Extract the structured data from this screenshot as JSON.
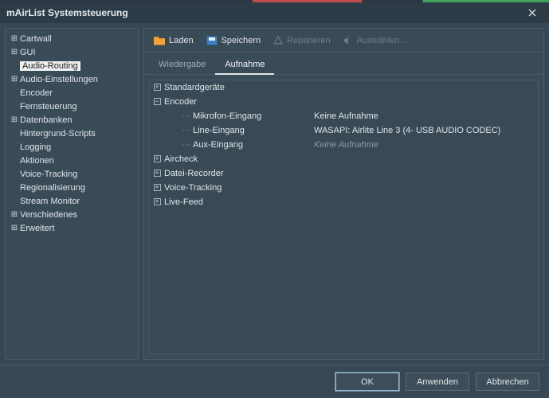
{
  "window": {
    "title": "mAirList Systemsteuerung"
  },
  "sidebar": {
    "items": [
      {
        "label": "Cartwall",
        "expander": "+"
      },
      {
        "label": "GUI",
        "expander": "+"
      },
      {
        "label": "Audio-Routing",
        "expander": "",
        "selected": true
      },
      {
        "label": "Audio-Einstellungen",
        "expander": "+"
      },
      {
        "label": "Encoder",
        "expander": "",
        "indent": 1
      },
      {
        "label": "Fernsteuerung",
        "expander": "",
        "indent": 1
      },
      {
        "label": "Datenbanken",
        "expander": "+"
      },
      {
        "label": "Hintergrund-Scripts",
        "expander": "",
        "indent": 1
      },
      {
        "label": "Logging",
        "expander": "",
        "indent": 1
      },
      {
        "label": "Aktionen",
        "expander": "",
        "indent": 1
      },
      {
        "label": "Voice-Tracking",
        "expander": "",
        "indent": 1
      },
      {
        "label": "Regionalisierung",
        "expander": "",
        "indent": 1
      },
      {
        "label": "Stream Monitor",
        "expander": "",
        "indent": 1
      },
      {
        "label": "Verschiedenes",
        "expander": "+"
      },
      {
        "label": "Erweitert",
        "expander": "+"
      }
    ]
  },
  "toolbar": {
    "load": "Laden",
    "save": "Speichern",
    "repair": "Reparieren",
    "select": "Auswählen…"
  },
  "tabs": {
    "playback": "Wiedergabe",
    "record": "Aufnahme"
  },
  "grid": {
    "rows": [
      {
        "label": "Standardgeräte",
        "exp": "+",
        "lvl": 0
      },
      {
        "label": "Encoder",
        "exp": "−",
        "lvl": 0
      },
      {
        "label": "Mikrofon-Eingang",
        "lvl": 2,
        "value": "Keine Aufnahme"
      },
      {
        "label": "Line-Eingang",
        "lvl": 2,
        "value": "WASAPI: Airlite Line 3 (4- USB AUDIO  CODEC)"
      },
      {
        "label": "Aux-Eingang",
        "lvl": 2,
        "value": "Keine Aufnahme",
        "italic": true
      },
      {
        "label": "Aircheck",
        "exp": "+",
        "lvl": 0
      },
      {
        "label": "Datei-Recorder",
        "exp": "+",
        "lvl": 0
      },
      {
        "label": "Voice-Tracking",
        "exp": "+",
        "lvl": 0
      },
      {
        "label": "Live-Feed",
        "exp": "+",
        "lvl": 0
      }
    ]
  },
  "footer": {
    "ok": "OK",
    "apply": "Anwenden",
    "cancel": "Abbrechen"
  }
}
